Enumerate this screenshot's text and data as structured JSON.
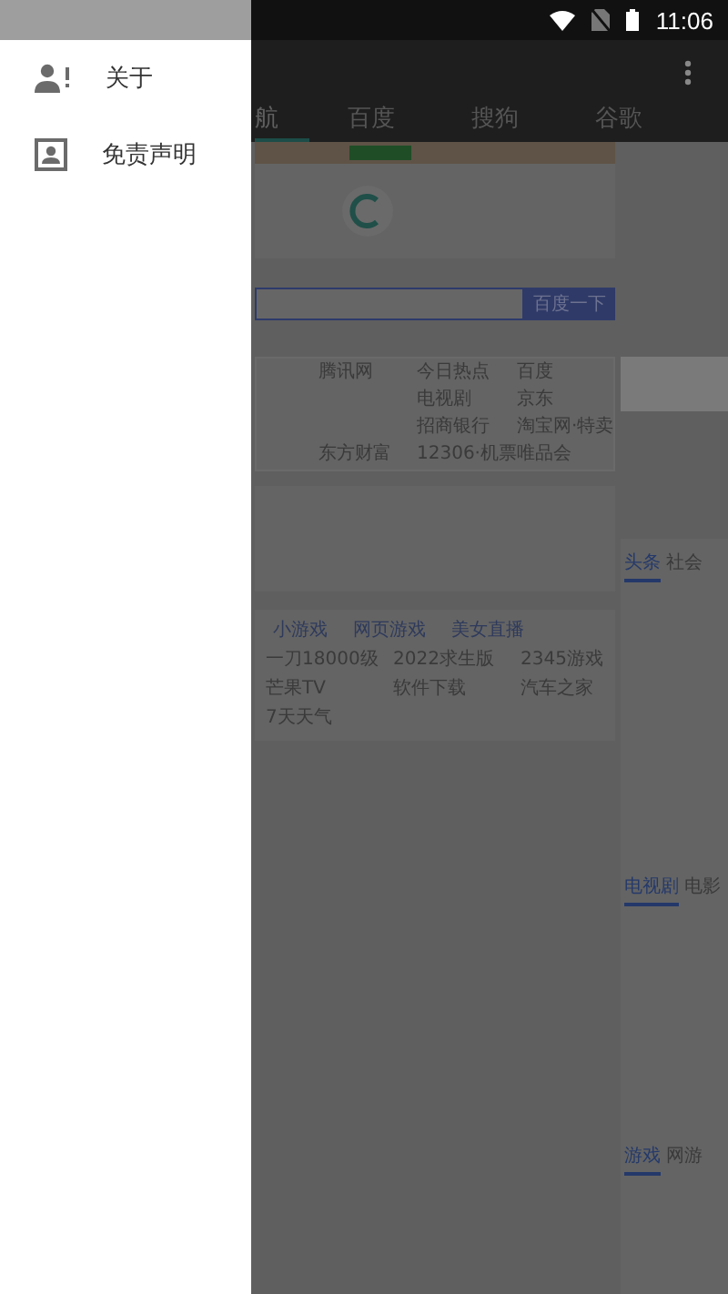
{
  "status_bar": {
    "time": "11:06"
  },
  "drawer": {
    "items": [
      {
        "label": "关于",
        "kind": "about"
      },
      {
        "label": "免责声明",
        "kind": "disclaimer"
      }
    ]
  },
  "tabs": [
    {
      "label": "航",
      "selected": true
    },
    {
      "label": "百度",
      "selected": false
    },
    {
      "label": "搜狗",
      "selected": false
    },
    {
      "label": "谷歌",
      "selected": false
    }
  ],
  "webpage": {
    "search_button": "百度一下",
    "link_rows": [
      {
        "column_2": "腾讯网",
        "column_3": "今日热点",
        "column_4": "百度"
      },
      {
        "column_3": "电视剧",
        "column_4": "京东"
      },
      {
        "column_3": "招商银行",
        "column_4": "淘宝网·特卖"
      },
      {
        "column_2": "东方财富",
        "column_3": "12306·机票",
        "column_4": "唯品会"
      }
    ],
    "game_tabs_top": [
      "小游戏",
      "网页游戏",
      "美女直播"
    ],
    "game_links": [
      "一刀18000级",
      "2022求生版",
      "2345游戏",
      "芒果TV",
      "软件下载",
      "汽车之家",
      "7天天气"
    ],
    "news_tabs": [
      {
        "label": "头条",
        "selected": true
      },
      {
        "label": "社会",
        "selected": false
      }
    ],
    "video_tabs": [
      {
        "label": "电视剧",
        "selected": true
      },
      {
        "label": "电影",
        "selected": false
      }
    ],
    "game_tabs": [
      {
        "label": "游戏",
        "selected": true
      },
      {
        "label": "网游",
        "selected": false
      }
    ]
  }
}
